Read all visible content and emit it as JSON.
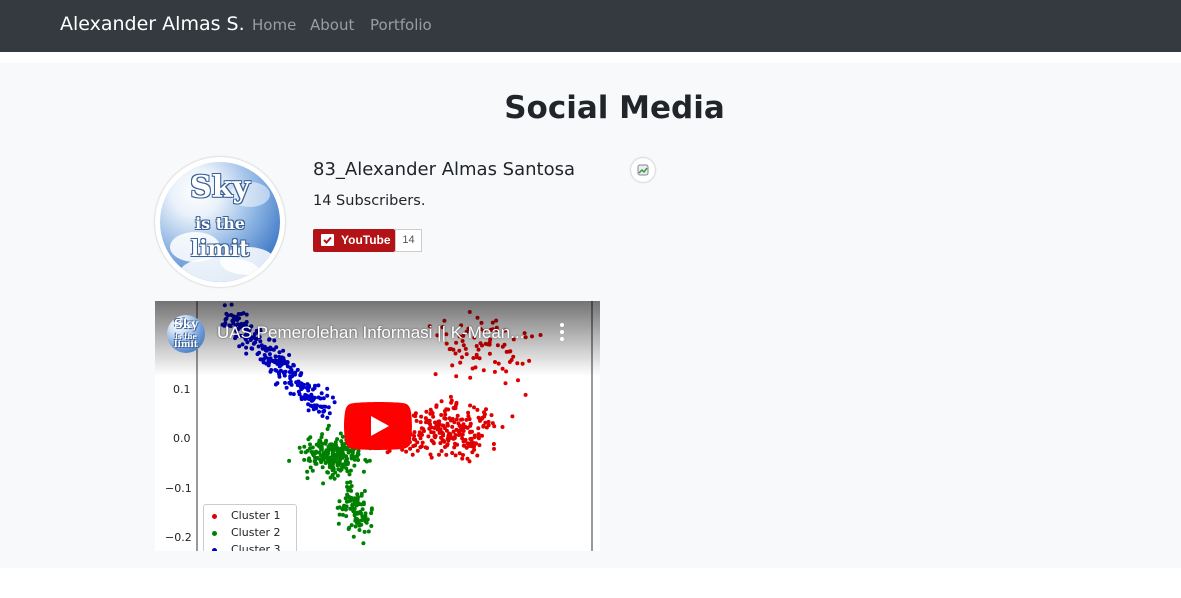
{
  "navbar": {
    "brand": "Alexander Almas S.",
    "links": [
      "Home",
      "About",
      "Portfolio"
    ]
  },
  "social": {
    "title": "Social Media",
    "channel_name": "83_Alexander Almas Santosa",
    "subscribers_text": "14 Subscribers.",
    "youtube_button_label": "YouTube",
    "subscriber_count": "14"
  },
  "logo": {
    "line1": "Sky",
    "line2": "is the",
    "line3": "limit"
  },
  "video": {
    "title": "UAS Pemerolehan Informasi || K-Mean...",
    "y_ticks": [
      "0.1",
      "0.0",
      "−0.1",
      "−0.2"
    ],
    "legend": [
      "Cluster 1",
      "Cluster 2",
      "Cluster 3"
    ],
    "colors": {
      "cluster1": "#e00000",
      "cluster2": "#008000",
      "cluster3": "#0000cc"
    }
  },
  "colors": {
    "navbar_bg": "#343a40",
    "youtube_red": "#b31217",
    "play_red": "#ff0000"
  },
  "icons": [
    "check-icon",
    "play-icon",
    "more-vert-icon",
    "channel-logo-icon"
  ]
}
